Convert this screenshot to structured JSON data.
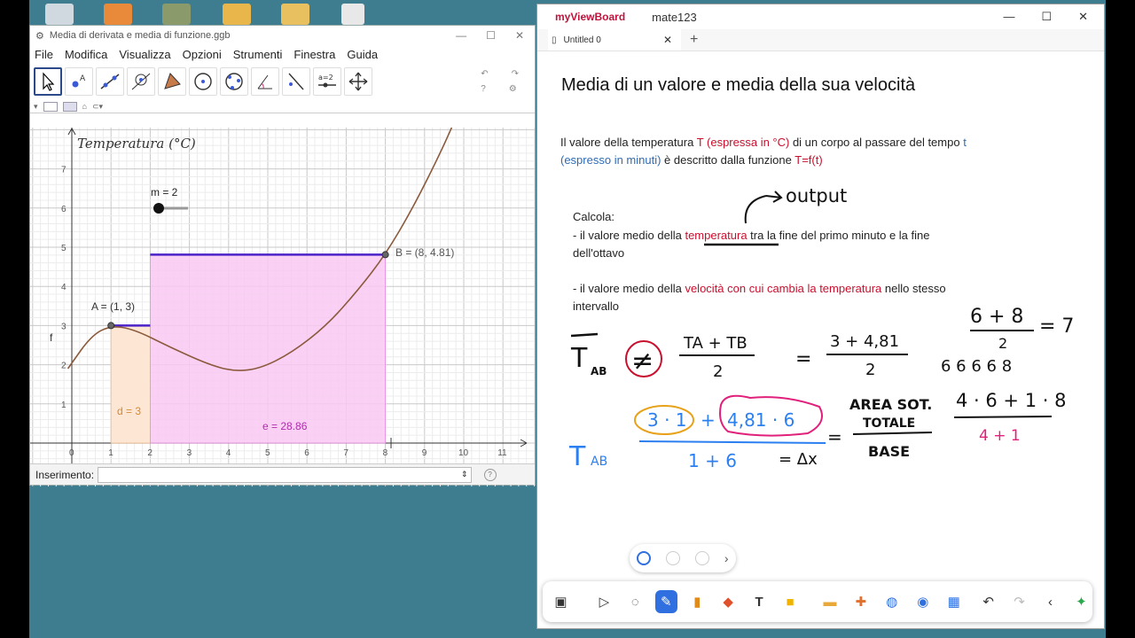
{
  "ggb": {
    "title": "Media di derivata e media di funzione.ggb",
    "menu": [
      "File",
      "Modifica",
      "Visualizza",
      "Opzioni",
      "Strumenti",
      "Finestra",
      "Guida"
    ],
    "tool_label": "a=2",
    "graph": {
      "y_axis_label": "Temperatura (°C)",
      "slider_label": "m = 2",
      "point_a": "A = (1, 3)",
      "point_b": "B = (8, 4.81)",
      "f_label": "f",
      "d_label": "d = 3",
      "e_label": "e = 28.86",
      "x_ticks": [
        "0",
        "1",
        "2",
        "3",
        "4",
        "5",
        "6",
        "7",
        "8",
        "9",
        "10",
        "11"
      ],
      "y_ticks": [
        "1",
        "2",
        "3",
        "4",
        "5",
        "6",
        "7"
      ]
    },
    "input_label": "Inserimento:",
    "help_icon": "?"
  },
  "mvb": {
    "logo": "myViewBoard",
    "user": "mate123",
    "tab_label": "Untitled 0",
    "heading": "Media di un valore e media della sua velocità",
    "p1": {
      "a": "Il valore della temperatura ",
      "b": "T (espressa in °C)",
      "c": " di un corpo al passare del tempo ",
      "d": "t",
      "e": "(espresso in minuti)",
      "f": " è descritto dalla funzione ",
      "g": "T=f(t)"
    },
    "calcola": "Calcola:",
    "item1": {
      "a": "- il valore medio della ",
      "b": "temperatura",
      "c": " tra la fine del primo minuto e la fine",
      "d": "dell'ottavo"
    },
    "item2": {
      "a": "- il valore medio della ",
      "b": "velocità con cui cambia la temperatura",
      "c": " nello stesso",
      "d": "intervallo"
    },
    "hw": {
      "output": "output",
      "t_a": "T",
      "sub_ab": "AB",
      "neq": "≠",
      "frac1_num": "TA + TB",
      "frac1_den": "2",
      "eq": "=",
      "frac2_num": "3 + 4,81",
      "frac2_den": "2",
      "frac3_num": "6 + 8",
      "frac3_den": "2",
      "seven": "= 7",
      "seq": "6  6  6  6  8",
      "b_num1": "3 · 1",
      "plus": "+",
      "b_num2": "4,81 · 6",
      "b_den": "1 + 6",
      "dx": "= Δx",
      "area1": "AREA SOT.",
      "area2": "TOTALE",
      "base": "BASE",
      "r_num": "4 · 6 + 1 · 8",
      "r_den": "4 + 1"
    },
    "page_nav_next": "›"
  },
  "colors": {
    "desktop": "#3e7c90",
    "ggb_curve": "#8b5a3c",
    "rect_fill": "#f9c9f2",
    "strip_fill": "#fde6d4",
    "top_line": "#4b22c8",
    "accent_red": "#c8102e",
    "accent_blue": "#2f6bb5",
    "hw_blue": "#2b7ff0",
    "hw_pink": "#e0207a",
    "hw_orange": "#e7a21a"
  }
}
